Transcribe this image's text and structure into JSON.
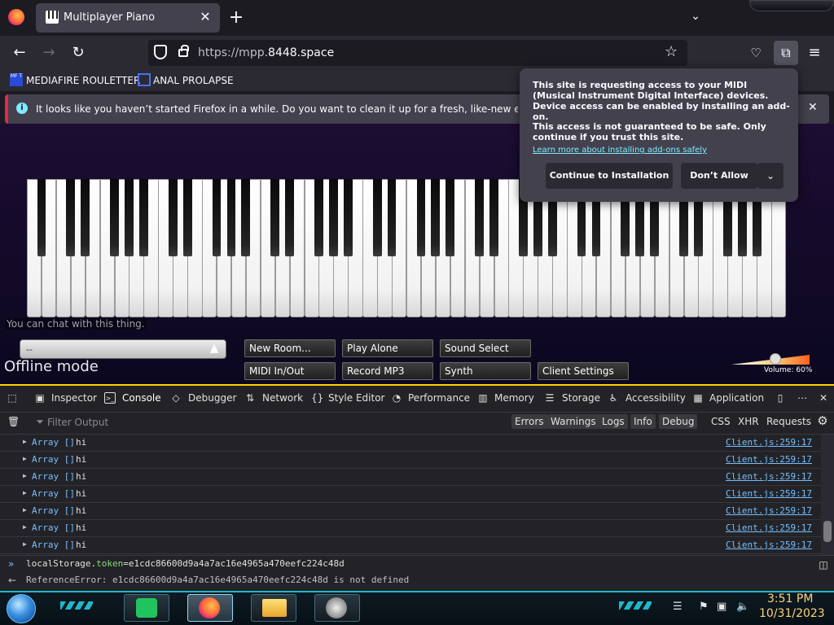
{
  "browser": {
    "tab_title": "Multiplayer Piano",
    "tab_close": "✕",
    "new_tab": "+",
    "url_prefix": "https://mpp.",
    "url_domain": "8448.space",
    "bookmarks": [
      "MEDIAFIRE ROULETTER",
      "ANAL PROLAPSE"
    ],
    "bookmark_icon1_text": "MF T",
    "notification": "It looks like you haven’t started Firefox in a while. Do you want to clean it up for a fresh, like-new experience? And",
    "notification_close": "✕"
  },
  "popup": {
    "para1": "This site is requesting access to your MIDI (Musical Instrument Digital Interface) devices. Device access can be enabled by installing an add-on.",
    "para2": "This access is not guaranteed to be safe. Only continue if you trust this site.",
    "link": "Learn more about installing add-ons safely",
    "continue": "Continue to Installation",
    "dont_allow": "Don’t Allow"
  },
  "piano": {
    "chat_hint": "You can chat with this thing.",
    "room_select": "--",
    "status": "Offline mode",
    "buttons": {
      "new_room": "New Room...",
      "play_alone": "Play Alone",
      "sound_select": "Sound Select",
      "midi": "MIDI In/Out",
      "record": "Record MP3",
      "synth": "Synth",
      "client_settings": "Client Settings"
    },
    "volume_label": "Volume: 60%",
    "volume_level": 0.6
  },
  "devtools": {
    "tabs": [
      "Inspector",
      "Console",
      "Debugger",
      "Network",
      "Style Editor",
      "Performance",
      "Memory",
      "Storage",
      "Accessibility",
      "Application"
    ],
    "filter_placeholder": "Filter Output",
    "levels": [
      "Errors",
      "Warnings",
      "Logs",
      "Info",
      "Debug"
    ],
    "extra_filters": [
      "CSS",
      "XHR",
      "Requests"
    ],
    "logs": [
      {
        "type": "Array []",
        "msg": "hi",
        "src": "Client.js:259:17"
      },
      {
        "type": "Array []",
        "msg": "hi",
        "src": "Client.js:259:17"
      },
      {
        "type": "Array []",
        "msg": "hi",
        "src": "Client.js:259:17"
      },
      {
        "type": "Array []",
        "msg": "hi",
        "src": "Client.js:259:17"
      },
      {
        "type": "Array []",
        "msg": "hi",
        "src": "Client.js:259:17"
      },
      {
        "type": "Array []",
        "msg": "hi",
        "src": "Client.js:259:17"
      },
      {
        "type": "Array []",
        "msg": "hi",
        "src": "Client.js:259:17"
      }
    ],
    "input_obj": "localStorage.",
    "input_prop": "token",
    "input_rest": "=e1cdc86600d9a4a7ac16e4965a470eefc224c48d",
    "error": "ReferenceError: e1cdc86600d9a4a7ac16e4965a470eefc224c48d is not defined"
  },
  "taskbar": {
    "time": "3:51 PM",
    "date": "10/31/2023"
  }
}
